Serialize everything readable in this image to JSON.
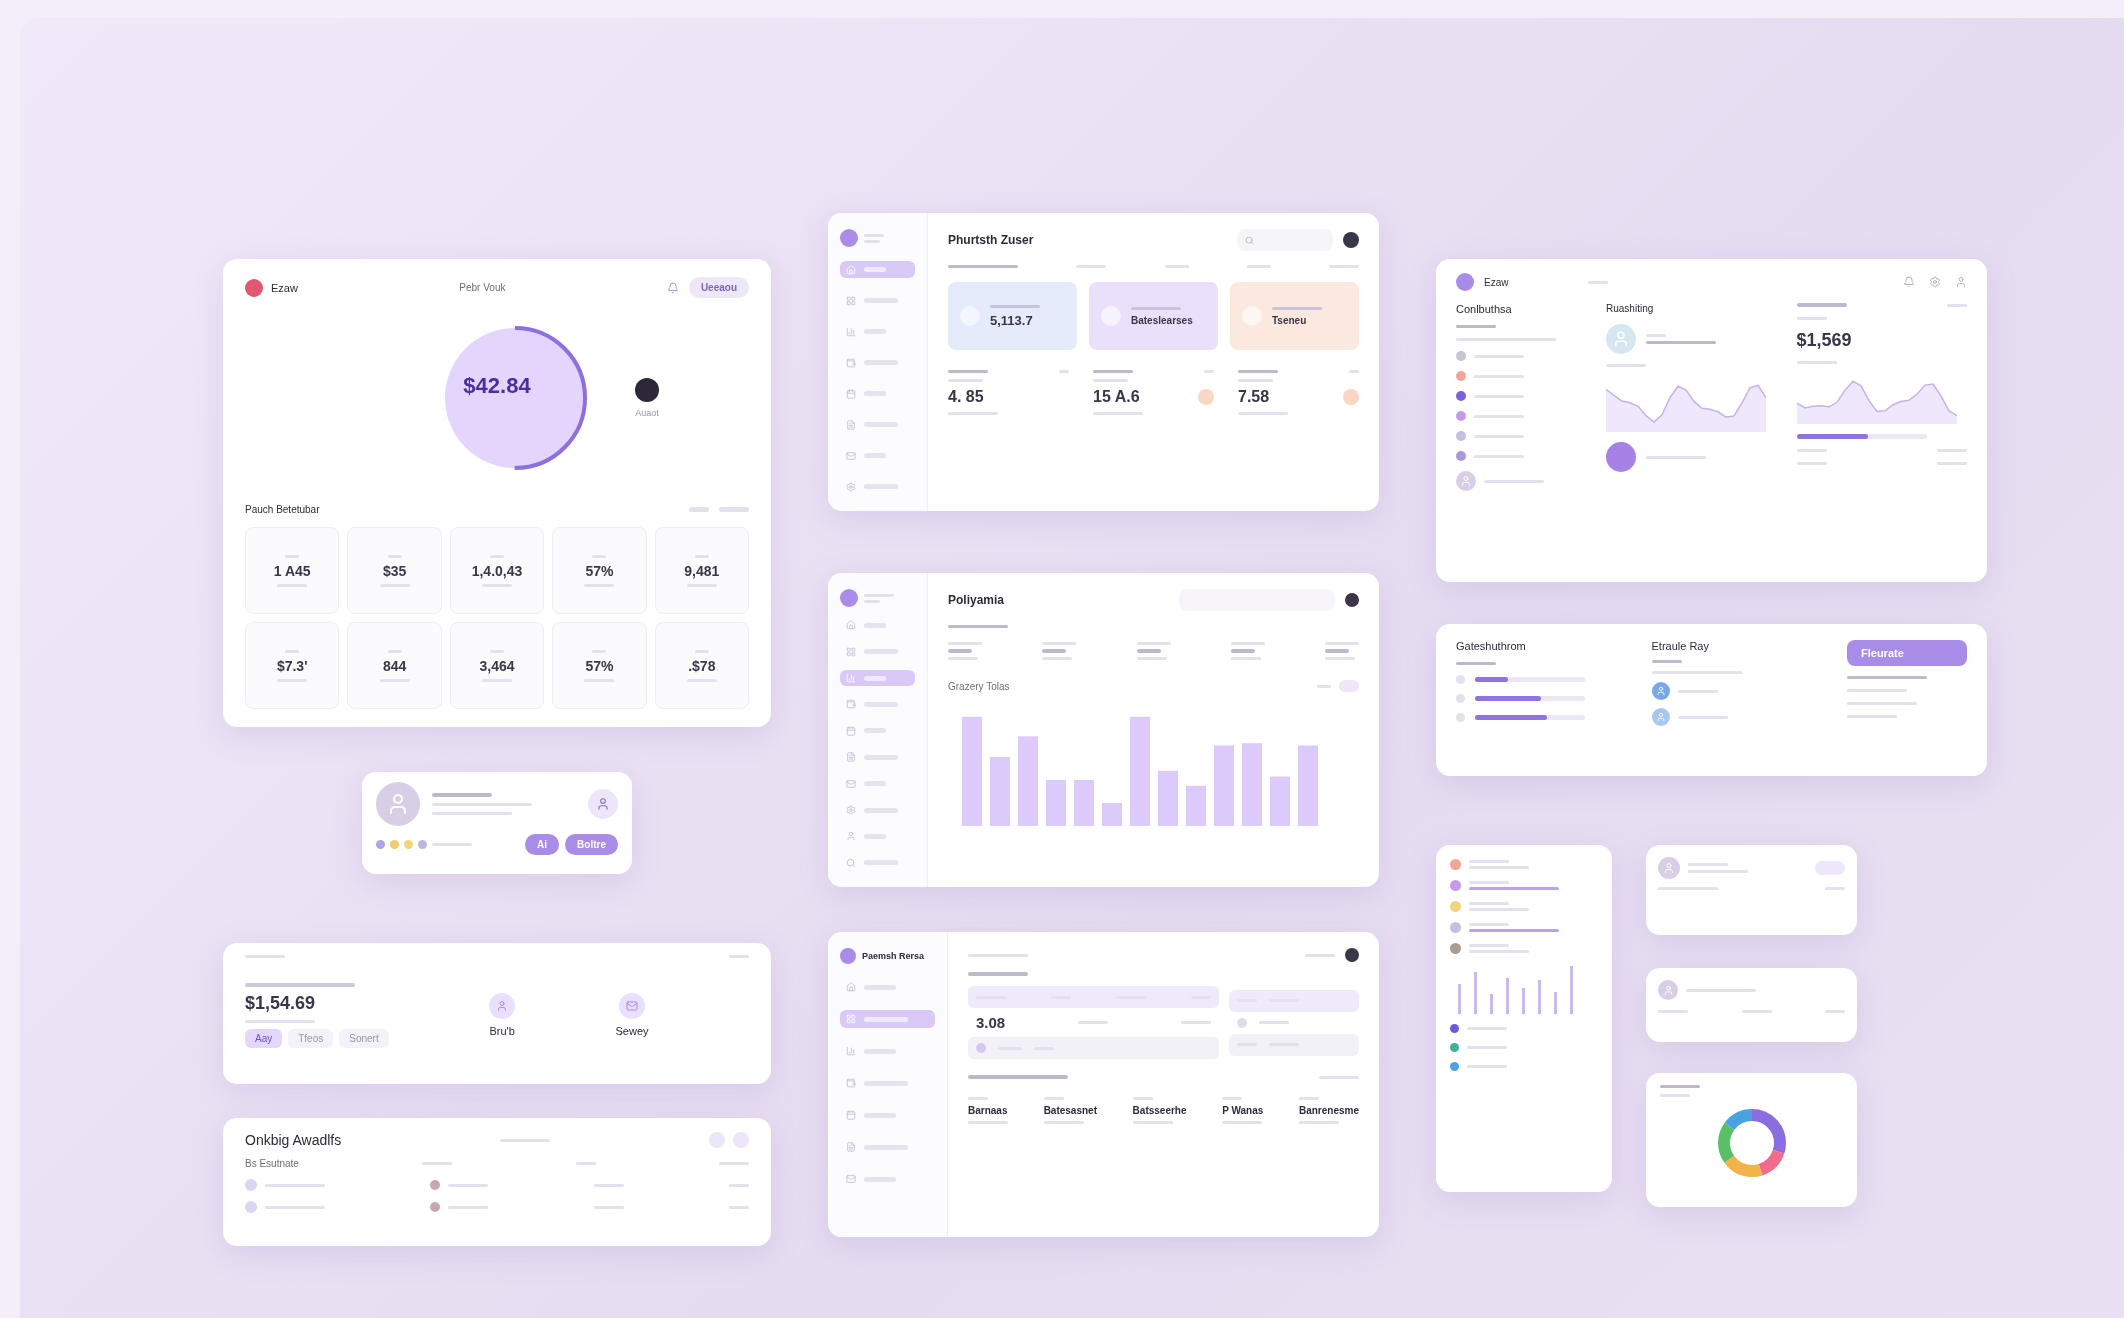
{
  "card_a": {
    "brand": "Ezaw",
    "title": "Pebr Vouk",
    "button": "Ueeaou",
    "ring_value": "$42.84",
    "ring": {
      "level": 0.5
    },
    "legend": "Auaot",
    "section_title": "Pauch Betetubar",
    "stats": [
      "1 A45",
      "$35",
      "1,4.0,43",
      "57%",
      "9,481",
      "$7.3'",
      "844",
      "3,464",
      "57%",
      ".$78"
    ]
  },
  "profile_card": {
    "buttons": [
      "Ai",
      "Boltre"
    ]
  },
  "savings_card": {
    "amount": "$1,54.69",
    "items": [
      "Bru'b",
      "Sewey"
    ],
    "chips": [
      {
        "label": "Aay",
        "selected": true
      },
      {
        "label": "Tfeos",
        "selected": false
      },
      {
        "label": "Sonert",
        "selected": false
      }
    ]
  },
  "activity_card": {
    "title": "Onkbig Awadlfs",
    "column": "Bs Esutnate"
  },
  "portfolio_card": {
    "title": "Phurtsth Zuser",
    "nav": [
      {
        "selected": true
      },
      {
        "selected": false
      },
      {
        "selected": false
      },
      {
        "selected": false
      },
      {
        "selected": false
      },
      {
        "selected": false
      },
      {
        "selected": false
      },
      {
        "selected": false
      }
    ],
    "tiles": [
      {
        "value": "5,113.7",
        "color": "#e4ebfb"
      },
      {
        "value": "Bateslearses",
        "color": "#ebe0fb"
      },
      {
        "value": "Tseneu",
        "color": "#fbe8de"
      }
    ],
    "stats": [
      "4. 85",
      "15 A.6",
      "7.58"
    ]
  },
  "sales_card": {
    "title": "Poliyamia",
    "chart_title": "Grazery Tolas",
    "nav": [
      {
        "selected": false
      },
      {
        "selected": false
      },
      {
        "selected": true
      },
      {
        "selected": false
      },
      {
        "selected": false
      },
      {
        "selected": false
      },
      {
        "selected": false
      },
      {
        "selected": false
      },
      {
        "selected": false
      },
      {
        "selected": false
      }
    ]
  },
  "orders_card": {
    "title": "Paemsh Rersa",
    "value": "3.08",
    "nav": [
      {
        "selected": false
      },
      {
        "selected": true
      },
      {
        "selected": false
      },
      {
        "selected": false
      },
      {
        "selected": false
      },
      {
        "selected": false
      },
      {
        "selected": false
      }
    ],
    "stats": [
      "Barnaas",
      "Batesasnet",
      "Batsseerhe",
      "P Wanas",
      "Banrenesme"
    ]
  },
  "analytics_card": {
    "brand": "Ezaw",
    "left_title": "Conlbuthsa",
    "mid_title": "Ruashiting",
    "amount": "$1,569",
    "progress": {
      "level": 0.55
    }
  },
  "goals_card": {
    "title": "Gateshuthrom",
    "subtitle": "Etraule Ray",
    "button": "Fleurate",
    "bars": [
      {
        "level": 0.3
      },
      {
        "level": 0.6
      },
      {
        "level": 0.65
      }
    ]
  },
  "legend_card": {
    "items": [
      {
        "color": "#6b5bd6"
      },
      {
        "color": "#3fb39a"
      },
      {
        "color": "#4aa3e0"
      }
    ]
  }
}
